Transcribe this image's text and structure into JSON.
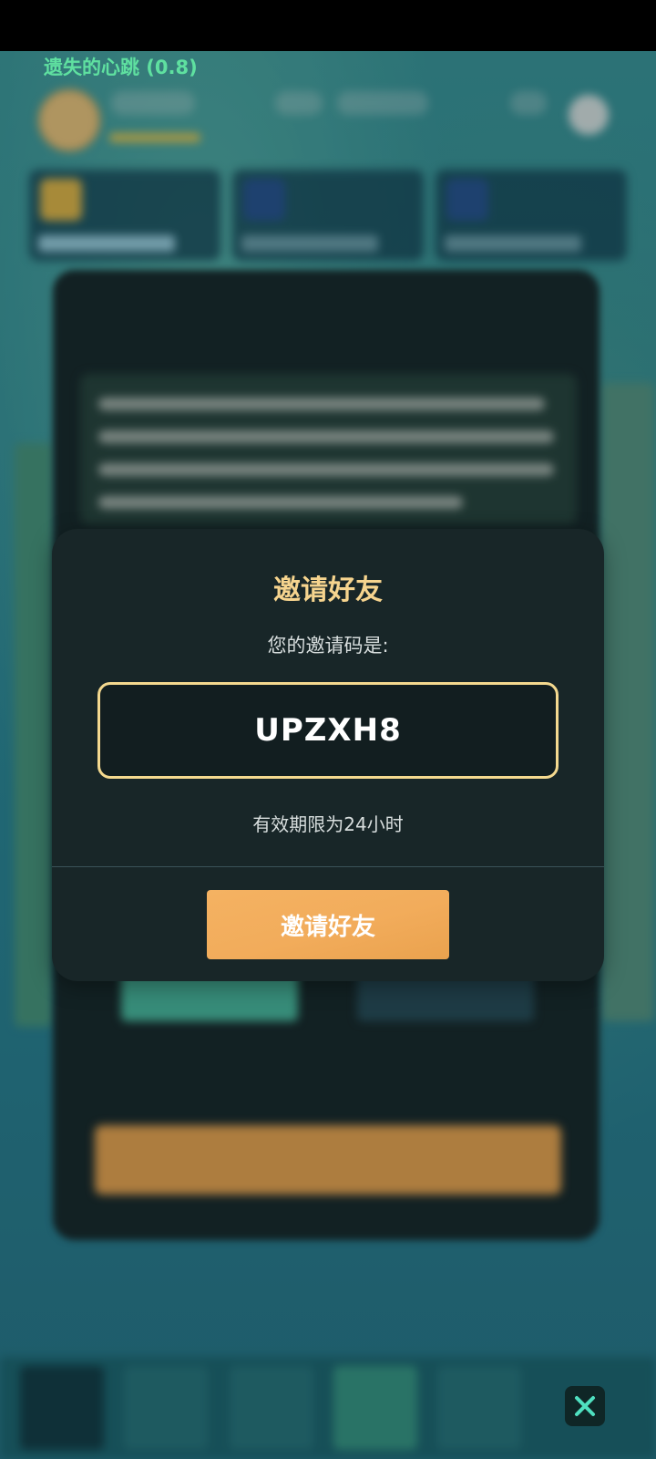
{
  "game": {
    "title": "遗失的心跳 (0.8)"
  },
  "modal": {
    "title": "邀请好友",
    "subtitle": "您的邀请码是:",
    "code": "UPZXH8",
    "validity": "有效期限为24小时",
    "button_label": "邀请好友"
  },
  "colors": {
    "accent_gold": "#f6d48e",
    "button_orange": "#f2ac5b",
    "modal_bg": "#182628",
    "game_title_green": "#5fe0a0"
  },
  "icons": {
    "close": "close-icon"
  }
}
